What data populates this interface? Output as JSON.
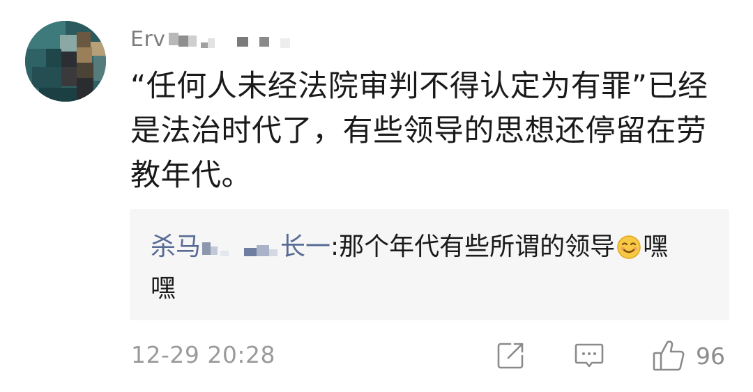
{
  "comment": {
    "username_visible": "Erv",
    "body_lines": [
      "“任何人未经法院审判不得认定为有罪”已经",
      "是法治时代了，有些领导的思想还停留在劳",
      "教年代。"
    ],
    "reply": {
      "username_prefix": "杀马",
      "username_suffix": "长一",
      "separator": ":",
      "text_before_emoji": " 那个年代有些所谓的领导",
      "text_after_emoji": "嘿",
      "text_line2": "嘿",
      "emoji_icon": "smirk-emoji"
    },
    "timestamp": "12-29 20:28",
    "like_count": "96"
  },
  "icons": {
    "share": "share-icon",
    "reply": "comment-icon",
    "like": "thumbs-up-icon"
  },
  "colors": {
    "reply_username": "#576b95",
    "muted_text": "#9b9b9b",
    "reply_background": "#f6f6f6"
  }
}
